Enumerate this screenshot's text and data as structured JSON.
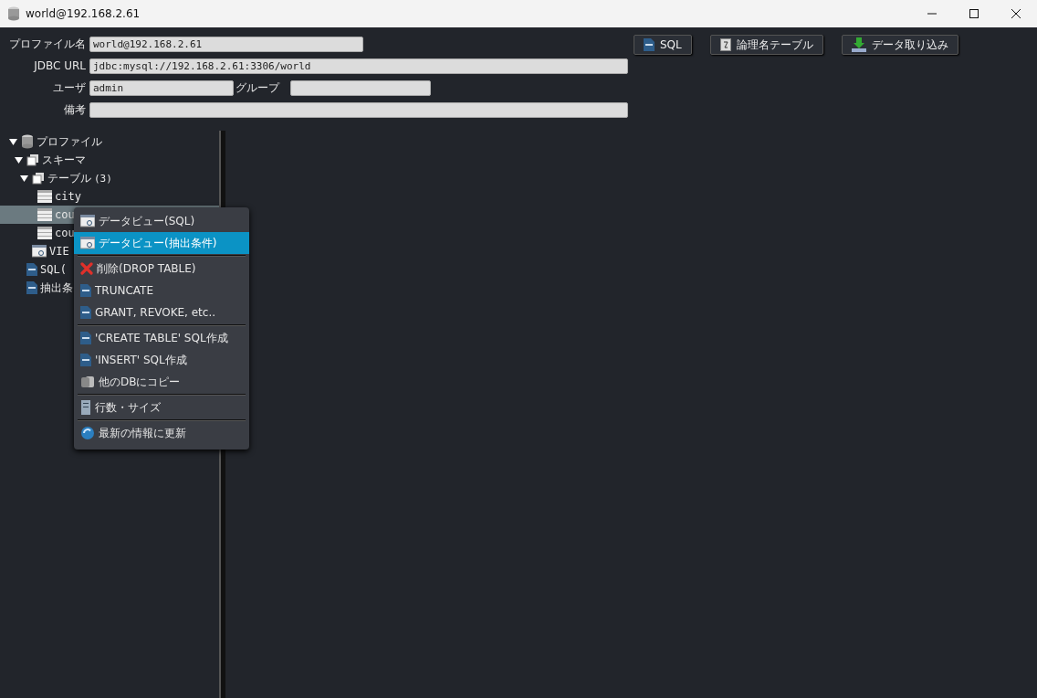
{
  "window": {
    "title": "world@192.168.2.61"
  },
  "form": [
    {
      "label": "プロファイル名",
      "value": "world@192.168.2.61",
      "kind": "medium"
    },
    {
      "label": "JDBC URL",
      "value": "jdbc:mysql://192.168.2.61:3306/world",
      "kind": "wide"
    },
    {
      "label": "ユーザ",
      "value": "admin",
      "kind": "pair",
      "label2": "グループ"
    },
    {
      "label": "備考",
      "kind": "wide"
    }
  ],
  "toolbar": [
    {
      "label": "SQL"
    },
    {
      "label": "論理名テーブル"
    },
    {
      "label": "データ取り込み"
    }
  ],
  "tree": [
    {
      "label": "プロファイル",
      "kind": "db",
      "expanded": true,
      "selected": false,
      "children": [
        {
          "label": "スキーマ",
          "kind": "schema",
          "expanded": true,
          "selected": false,
          "children": [
            {
              "label": "テーブル",
              "count": "(3)",
              "kind": "schema",
              "expanded": true,
              "selected": false,
              "children": [
                {
                  "label": "city",
                  "kind": "table",
                  "selected": false
                },
                {
                  "label": "cou",
                  "kind": "table",
                  "selected": true
                },
                {
                  "label": "cou",
                  "kind": "table",
                  "selected": false
                }
              ]
            },
            {
              "label": "VIE",
              "kind": "view",
              "selected": false
            }
          ]
        },
        {
          "label": "SQL(",
          "kind": "sql",
          "selected": false
        },
        {
          "label": "抽出条",
          "kind": "sql",
          "selected": false
        }
      ]
    }
  ],
  "context_menu": [
    {
      "kind": "view",
      "label": "データビュー(SQL)",
      "selected": false
    },
    {
      "kind": "view",
      "label": "データビュー(抽出条件)",
      "selected": true
    },
    {
      "kind": "separator"
    },
    {
      "kind": "delete",
      "label": "削除(DROP TABLE)",
      "selected": false
    },
    {
      "kind": "sql",
      "label": "TRUNCATE",
      "selected": false
    },
    {
      "kind": "sql",
      "label": "GRANT, REVOKE, etc..",
      "selected": false
    },
    {
      "kind": "separator"
    },
    {
      "kind": "sql",
      "label": "'CREATE TABLE' SQL作成",
      "selected": false
    },
    {
      "kind": "sql",
      "label": "'INSERT' SQL作成",
      "selected": false
    },
    {
      "kind": "copy",
      "label": "他のDBにコピー",
      "selected": false
    },
    {
      "kind": "separator"
    },
    {
      "kind": "rows",
      "label": "行数・サイズ",
      "selected": false
    },
    {
      "kind": "separator"
    },
    {
      "kind": "refresh",
      "label": "最新の情報に更新",
      "selected": false
    }
  ]
}
